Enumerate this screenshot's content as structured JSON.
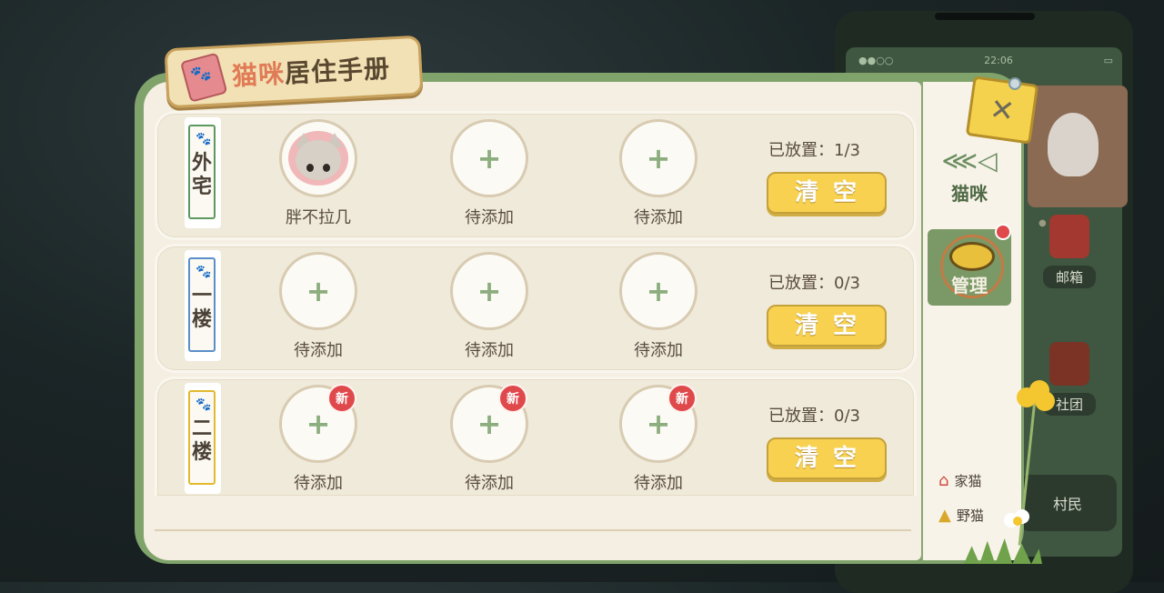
{
  "title": {
    "accent": "猫咪",
    "rest": "居住手册"
  },
  "close_label": "✕",
  "rows": [
    {
      "tag": "外宅",
      "tag_color": "#5d9a60",
      "slots": [
        {
          "label": "胖不拉几",
          "filled": true,
          "new": false
        },
        {
          "label": "待添加",
          "filled": false,
          "new": false
        },
        {
          "label": "待添加",
          "filled": false,
          "new": false
        }
      ],
      "placed": "已放置：1/3",
      "clear_label": "清空"
    },
    {
      "tag": "一楼",
      "tag_color": "#5a8fc9",
      "slots": [
        {
          "label": "待添加",
          "filled": false,
          "new": false
        },
        {
          "label": "待添加",
          "filled": false,
          "new": false
        },
        {
          "label": "待添加",
          "filled": false,
          "new": false
        }
      ],
      "placed": "已放置：0/3",
      "clear_label": "清空"
    },
    {
      "tag": "二楼",
      "tag_color": "#e2b92f",
      "slots": [
        {
          "label": "待添加",
          "filled": false,
          "new": true
        },
        {
          "label": "待添加",
          "filled": false,
          "new": true
        },
        {
          "label": "待添加",
          "filled": false,
          "new": true
        }
      ],
      "placed": "已放置：0/3",
      "clear_label": "清空"
    }
  ],
  "new_badge": "新",
  "plus_symbol": "+",
  "sidebar": {
    "cat_tab": "猫咪",
    "manage_tab": "管理",
    "legend": [
      {
        "icon": "house-icon",
        "label": "家猫"
      },
      {
        "icon": "tent-icon",
        "label": "野猫"
      }
    ]
  },
  "background_phone": {
    "mailbox": "邮箱",
    "club": "社团",
    "villager": "村民",
    "time": "22:06"
  }
}
